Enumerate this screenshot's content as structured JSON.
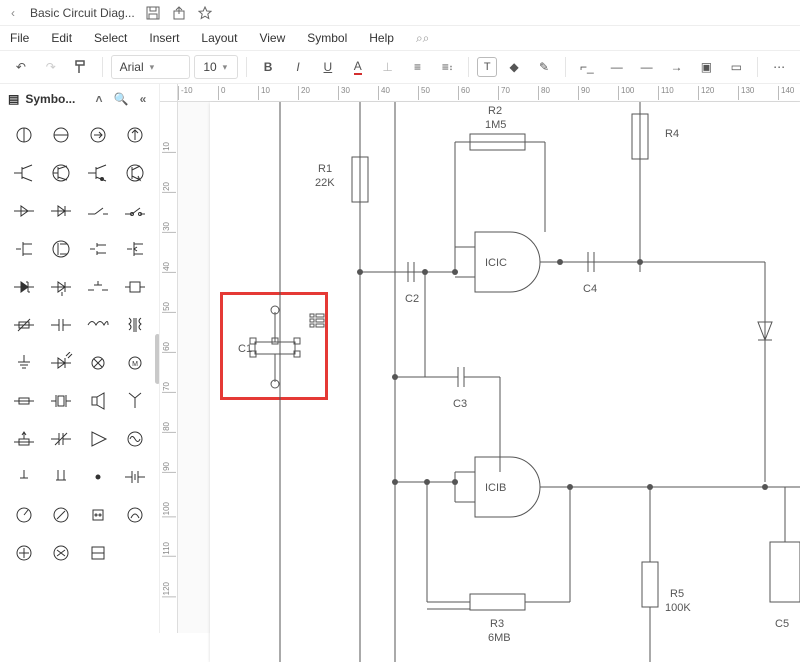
{
  "titlebar": {
    "back": "‹",
    "title": "Basic Circuit Diag..."
  },
  "menu": {
    "file": "File",
    "edit": "Edit",
    "select": "Select",
    "insert": "Insert",
    "layout": "Layout",
    "view": "View",
    "symbol": "Symbol",
    "help": "Help"
  },
  "toolbar": {
    "font": "Arial",
    "size": "10"
  },
  "panel": {
    "title": "Symbo..."
  },
  "ruler_h": [
    {
      "pos": 0,
      "label": "-10"
    },
    {
      "pos": 40,
      "label": "0"
    },
    {
      "pos": 80,
      "label": "10"
    },
    {
      "pos": 120,
      "label": "20"
    },
    {
      "pos": 160,
      "label": "30"
    },
    {
      "pos": 200,
      "label": "40"
    },
    {
      "pos": 240,
      "label": "50"
    },
    {
      "pos": 280,
      "label": "60"
    },
    {
      "pos": 320,
      "label": "70"
    },
    {
      "pos": 360,
      "label": "80"
    },
    {
      "pos": 400,
      "label": "90"
    },
    {
      "pos": 440,
      "label": "100"
    },
    {
      "pos": 480,
      "label": "110"
    },
    {
      "pos": 520,
      "label": "120"
    },
    {
      "pos": 560,
      "label": "130"
    },
    {
      "pos": 600,
      "label": "140"
    }
  ],
  "ruler_v": [
    {
      "pos": 40,
      "label": "10"
    },
    {
      "pos": 80,
      "label": "20"
    },
    {
      "pos": 120,
      "label": "30"
    },
    {
      "pos": 160,
      "label": "40"
    },
    {
      "pos": 200,
      "label": "50"
    },
    {
      "pos": 240,
      "label": "60"
    },
    {
      "pos": 280,
      "label": "70"
    },
    {
      "pos": 320,
      "label": "80"
    },
    {
      "pos": 360,
      "label": "90"
    },
    {
      "pos": 400,
      "label": "100"
    },
    {
      "pos": 440,
      "label": "110"
    },
    {
      "pos": 480,
      "label": "120"
    }
  ],
  "labels": {
    "R1": "R1",
    "R1v": "22K",
    "R2": "R2",
    "R2v": "1M5",
    "R4": "R4",
    "C1": "C1",
    "C2": "C2",
    "C3": "C3",
    "C4": "C4",
    "C5": "C5",
    "ICIC": "ICIC",
    "ICIB": "ICIB",
    "R3": "R3",
    "R3v": "6MB",
    "R5": "R5",
    "R5v": "100K"
  }
}
